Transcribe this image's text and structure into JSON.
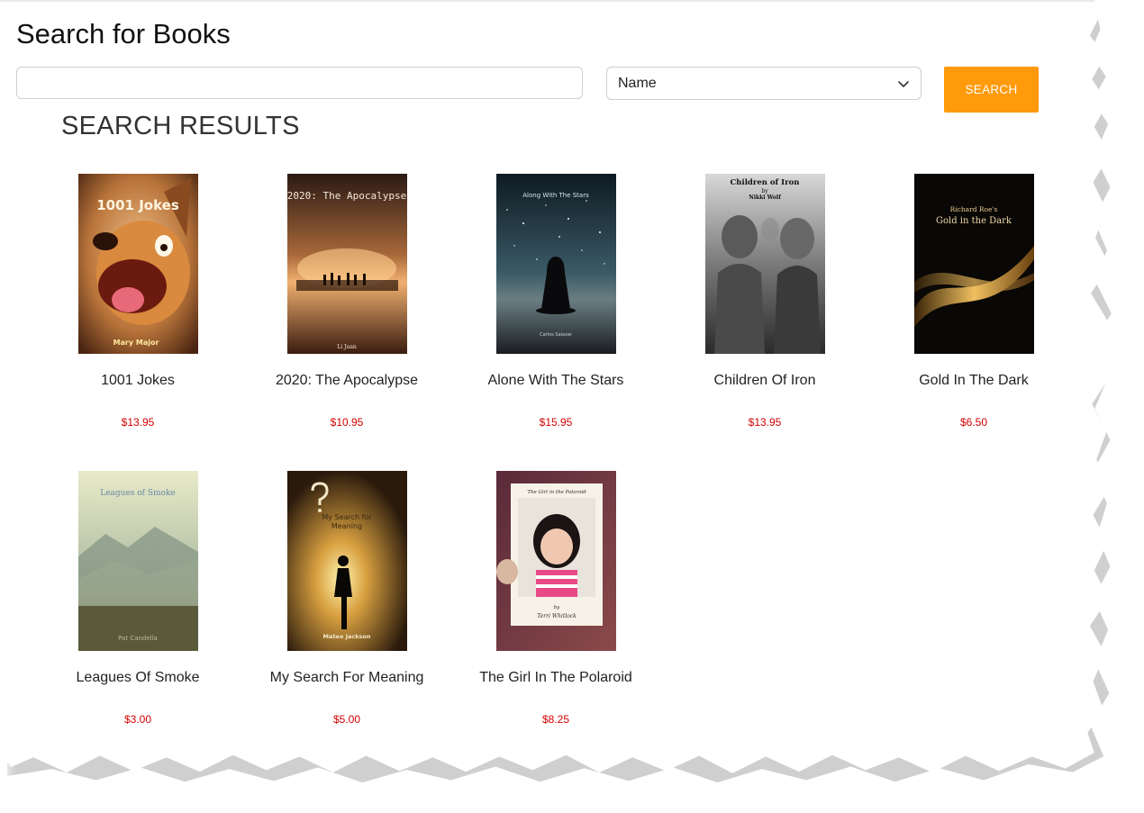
{
  "header": {
    "title": "Search for Books"
  },
  "search": {
    "value": "",
    "placeholder": "",
    "field_selected": "Name",
    "button_label": "SEARCH"
  },
  "results": {
    "heading": "SEARCH RESULTS",
    "books": [
      {
        "title": "1001 Jokes",
        "price": "$13.95",
        "cover_title": "1001 Jokes",
        "cover_author": "Mary Major"
      },
      {
        "title": "2020: The Apocalypse",
        "price": "$10.95",
        "cover_title": "2020: The Apocalypse",
        "cover_author": "Li Juan"
      },
      {
        "title": "Alone With The Stars",
        "price": "$15.95",
        "cover_title": "Along With The Stars",
        "cover_author": "Carlos Salazar"
      },
      {
        "title": "Children Of Iron",
        "price": "$13.95",
        "cover_title": "Children of Iron",
        "cover_by": "by",
        "cover_author": "Nikki Wolf"
      },
      {
        "title": "Gold In The Dark",
        "price": "$6.50",
        "cover_title_line1": "Richard Roe's",
        "cover_title_line2": "Gold in the Dark"
      },
      {
        "title": "Leagues Of Smoke",
        "price": "$3.00",
        "cover_title": "Leagues of Smoke",
        "cover_author": "Pat Candella"
      },
      {
        "title": "My Search For Meaning",
        "price": "$5.00",
        "cover_title_line1": "My Search for",
        "cover_title_line2": "Meaning",
        "cover_author": "Mateo Jackson"
      },
      {
        "title": "The Girl In The Polaroid",
        "price": "$8.25",
        "cover_title": "The Girl in the Polaroid",
        "cover_by": "by",
        "cover_author": "Terri Whitlock"
      }
    ]
  },
  "colors": {
    "accent": "#ff9a0a",
    "price": "#d40000"
  }
}
